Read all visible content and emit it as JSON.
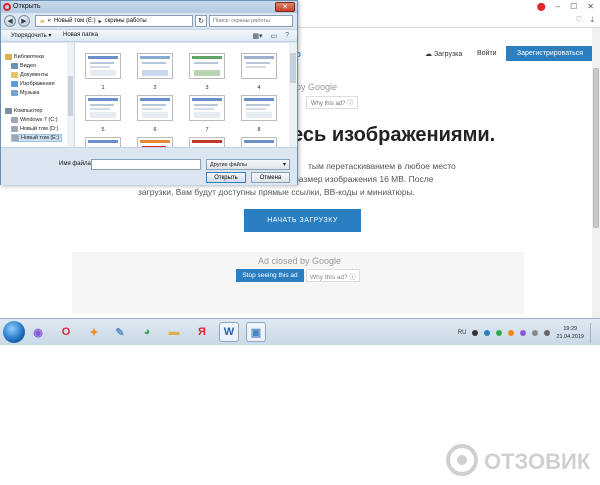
{
  "browser": {
    "minimize": "–",
    "maximize": "☐",
    "close": "✕"
  },
  "site": {
    "logo_fragment": "bb",
    "upload_link": "Загрузка",
    "login_link": "Войти",
    "register_button": "Зарегистрироваться",
    "headline": "есь изображениями.",
    "desc_line1": "тым перетаскиванием в любое место",
    "desc_line2": "размер изображения 16 MB. После",
    "desc_line3": "загрузки, Вам будут доступны прямые ссылки, BB-коды и миниатюры.",
    "start_upload_button": "НАЧАТЬ ЗАГРУЗКУ",
    "ad_top": {
      "closed_by": "by Google",
      "why_ad": "Why this ad? ⓘ"
    },
    "ad_band": {
      "closed_by": "Ad closed by Google",
      "stop_button": "Stop seeing this ad",
      "why_ad": "Why this ad? ⓘ"
    }
  },
  "dialog": {
    "title": "Открыть",
    "close": "✕",
    "path": [
      "Новый том (E:)",
      "скрины работы"
    ],
    "search_placeholder": "Поиск: скрины работы",
    "toolbar": {
      "organize": "Упорядочить ▾",
      "new_folder": "Новая папка"
    },
    "sidebar": [
      {
        "label": "Библиотеки",
        "color": "#d9b24b"
      },
      {
        "label": "Видео",
        "color": "#6d8fb3"
      },
      {
        "label": "Документы",
        "color": "#e3c56a"
      },
      {
        "label": "Изображения",
        "color": "#5c9ad6"
      },
      {
        "label": "Музыка",
        "color": "#7aa4cf"
      },
      {
        "label": "Компьютер",
        "color": "#7c8ea2"
      },
      {
        "label": "Windows 7 (C:)",
        "color": "#9aa8b8"
      },
      {
        "label": "Новый том (D:)",
        "color": "#9aa8b8"
      },
      {
        "label": "Новый том (E:)",
        "color": "#9aa8b8"
      }
    ],
    "files": [
      "1",
      "2",
      "3",
      "4",
      "5",
      "6",
      "7",
      "8",
      "",
      "",
      "",
      ""
    ],
    "filename_label": "Имя файла:",
    "filename_value": "",
    "filetype": "Другие файлы",
    "open_button": "Открыть",
    "cancel_button": "Отмена"
  },
  "taskbar": {
    "icons": [
      {
        "name": "alice-icon",
        "glyph": "◉",
        "color": "#8a5bd6"
      },
      {
        "name": "opera-icon",
        "glyph": "O",
        "color": "#e3262b"
      },
      {
        "name": "avast-icon",
        "glyph": "✦",
        "color": "#f08a1e"
      },
      {
        "name": "paint-icon",
        "glyph": "✎",
        "color": "#5a8cc7"
      },
      {
        "name": "chrome-icon",
        "glyph": "◕",
        "color": "#3aa757"
      },
      {
        "name": "folder-icon",
        "glyph": "▬",
        "color": "#d9b24b"
      },
      {
        "name": "yandex-icon",
        "glyph": "Я",
        "color": "#e3262b"
      },
      {
        "name": "word-icon",
        "glyph": "W",
        "color": "#2b5fa8"
      },
      {
        "name": "image-viewer-icon",
        "glyph": "▣",
        "color": "#4a86c5"
      }
    ],
    "lang": "RU",
    "time": "19:29",
    "date": "21.04.2019"
  },
  "watermark": "ОТЗОВИК"
}
